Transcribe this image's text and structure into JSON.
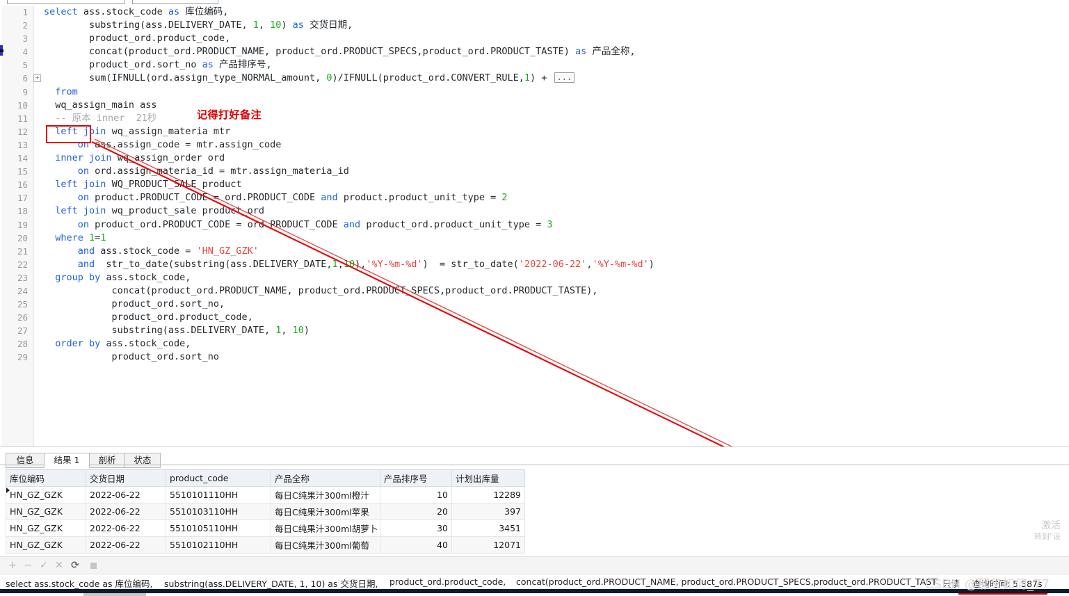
{
  "window": {
    "toolbar_boxes": [
      "",
      ""
    ]
  },
  "editor": {
    "lines": [
      {
        "n": "1",
        "fold": false,
        "indent": 0,
        "tokens": [
          {
            "t": "select",
            "c": "kw"
          },
          {
            "t": " ass.stock_code ",
            "c": ""
          },
          {
            "t": "as",
            "c": "kw"
          },
          {
            "t": " 库位编码,",
            "c": ""
          }
        ]
      },
      {
        "n": "2",
        "fold": false,
        "indent": 4,
        "tokens": [
          {
            "t": "substring(ass.DELIVERY_DATE, ",
            "c": ""
          },
          {
            "t": "1",
            "c": "num"
          },
          {
            "t": ", ",
            "c": ""
          },
          {
            "t": "10",
            "c": "num"
          },
          {
            "t": ") ",
            "c": ""
          },
          {
            "t": "as",
            "c": "kw"
          },
          {
            "t": " 交货日期,",
            "c": ""
          }
        ]
      },
      {
        "n": "3",
        "fold": false,
        "indent": 4,
        "tokens": [
          {
            "t": "product_ord.product_code,",
            "c": ""
          }
        ]
      },
      {
        "n": "4",
        "fold": false,
        "indent": 4,
        "tokens": [
          {
            "t": "concat(product_ord.PRODUCT_NAME, product_ord.PRODUCT_SPECS,product_ord.PRODUCT_TASTE) ",
            "c": ""
          },
          {
            "t": "as",
            "c": "kw"
          },
          {
            "t": " 产品全称,",
            "c": ""
          }
        ]
      },
      {
        "n": "5",
        "fold": false,
        "indent": 4,
        "tokens": [
          {
            "t": "product_ord.sort_no ",
            "c": ""
          },
          {
            "t": "as",
            "c": "kw"
          },
          {
            "t": " 产品排序号,",
            "c": ""
          }
        ]
      },
      {
        "n": "6",
        "fold": true,
        "indent": 4,
        "tokens": [
          {
            "t": "sum(IFNULL(ord.assign_type_NORMAL_amount, ",
            "c": ""
          },
          {
            "t": "0",
            "c": "num"
          },
          {
            "t": ")/IFNULL(product_ord.CONVERT_RULE,",
            "c": ""
          },
          {
            "t": "1",
            "c": "num"
          },
          {
            "t": ") + ",
            "c": ""
          },
          {
            "t": "...",
            "c": "ellipsis"
          }
        ]
      },
      {
        "n": "9",
        "fold": false,
        "indent": 1,
        "tokens": [
          {
            "t": "from",
            "c": "kw"
          }
        ]
      },
      {
        "n": "10",
        "fold": false,
        "indent": 1,
        "tokens": [
          {
            "t": "wq_assign_main ass",
            "c": ""
          }
        ]
      },
      {
        "n": "11",
        "fold": false,
        "indent": 1,
        "tokens": [
          {
            "t": "-- 原本 inner  21秒",
            "c": "cmt"
          }
        ]
      },
      {
        "n": "12",
        "fold": false,
        "indent": 1,
        "tokens": [
          {
            "t": "left",
            "c": "kw"
          },
          {
            "t": " ",
            "c": ""
          },
          {
            "t": "join",
            "c": "kw"
          },
          {
            "t": " wq_assign_materia mtr",
            "c": ""
          }
        ]
      },
      {
        "n": "13",
        "fold": false,
        "indent": 3,
        "tokens": [
          {
            "t": "on",
            "c": "kw"
          },
          {
            "t": " ass.assign_code = mtr.assign_code",
            "c": ""
          }
        ]
      },
      {
        "n": "14",
        "fold": false,
        "indent": 1,
        "tokens": [
          {
            "t": "inner",
            "c": "kw"
          },
          {
            "t": " ",
            "c": ""
          },
          {
            "t": "join",
            "c": "kw"
          },
          {
            "t": " wq_assign_order ord",
            "c": ""
          }
        ]
      },
      {
        "n": "15",
        "fold": false,
        "indent": 3,
        "tokens": [
          {
            "t": "on",
            "c": "kw"
          },
          {
            "t": " ord.assign_materia_id = mtr.assign_materia_id",
            "c": ""
          }
        ]
      },
      {
        "n": "16",
        "fold": false,
        "indent": 1,
        "tokens": [
          {
            "t": "left",
            "c": "kw"
          },
          {
            "t": " ",
            "c": ""
          },
          {
            "t": "join",
            "c": "kw"
          },
          {
            "t": " WQ_PRODUCT_SALE product",
            "c": ""
          }
        ]
      },
      {
        "n": "17",
        "fold": false,
        "indent": 3,
        "tokens": [
          {
            "t": "on",
            "c": "kw"
          },
          {
            "t": " product.PRODUCT_CODE = ord.PRODUCT_CODE ",
            "c": ""
          },
          {
            "t": "and",
            "c": "kw"
          },
          {
            "t": " product.product_unit_type = ",
            "c": ""
          },
          {
            "t": "2",
            "c": "num"
          }
        ]
      },
      {
        "n": "18",
        "fold": false,
        "indent": 1,
        "tokens": [
          {
            "t": "left",
            "c": "kw"
          },
          {
            "t": " ",
            "c": ""
          },
          {
            "t": "join",
            "c": "kw"
          },
          {
            "t": " wq_product_sale product_ord",
            "c": ""
          }
        ]
      },
      {
        "n": "19",
        "fold": false,
        "indent": 3,
        "tokens": [
          {
            "t": "on",
            "c": "kw"
          },
          {
            "t": " product_ord.PRODUCT_CODE = ord.PRODUCT_CODE ",
            "c": ""
          },
          {
            "t": "and",
            "c": "kw"
          },
          {
            "t": " product_ord.product_unit_type = ",
            "c": ""
          },
          {
            "t": "3",
            "c": "num"
          }
        ]
      },
      {
        "n": "20",
        "fold": false,
        "indent": 1,
        "tokens": [
          {
            "t": "where",
            "c": "kw"
          },
          {
            "t": " ",
            "c": ""
          },
          {
            "t": "1",
            "c": "num"
          },
          {
            "t": "=",
            "c": ""
          },
          {
            "t": "1",
            "c": "num"
          }
        ]
      },
      {
        "n": "21",
        "fold": false,
        "indent": 3,
        "tokens": [
          {
            "t": "and",
            "c": "kw"
          },
          {
            "t": " ass.stock_code = ",
            "c": ""
          },
          {
            "t": "'HN_GZ_GZK'",
            "c": "str"
          }
        ]
      },
      {
        "n": "22",
        "fold": false,
        "indent": 3,
        "tokens": [
          {
            "t": "and",
            "c": "kw"
          },
          {
            "t": "  str_to_date(substring(ass.DELIVERY_DATE,",
            "c": ""
          },
          {
            "t": "1",
            "c": "num"
          },
          {
            "t": ",",
            "c": ""
          },
          {
            "t": "10",
            "c": "num"
          },
          {
            "t": "),",
            "c": ""
          },
          {
            "t": "'%Y-%m-%d'",
            "c": "str"
          },
          {
            "t": ")  = str_to_date(",
            "c": ""
          },
          {
            "t": "'2022-06-22'",
            "c": "str"
          },
          {
            "t": ",",
            "c": ""
          },
          {
            "t": "'%Y-%m-%d'",
            "c": "str"
          },
          {
            "t": ")",
            "c": ""
          }
        ]
      },
      {
        "n": "23",
        "fold": false,
        "indent": 1,
        "tokens": [
          {
            "t": "group",
            "c": "kw"
          },
          {
            "t": " ",
            "c": ""
          },
          {
            "t": "by",
            "c": "kw"
          },
          {
            "t": " ass.stock_code,",
            "c": ""
          }
        ]
      },
      {
        "n": "24",
        "fold": false,
        "indent": 6,
        "tokens": [
          {
            "t": "concat(product_ord.PRODUCT_NAME, product_ord.PRODUCT_SPECS,product_ord.PRODUCT_TASTE),",
            "c": ""
          }
        ]
      },
      {
        "n": "25",
        "fold": false,
        "indent": 6,
        "tokens": [
          {
            "t": "product_ord.sort_no,",
            "c": ""
          }
        ]
      },
      {
        "n": "26",
        "fold": false,
        "indent": 6,
        "tokens": [
          {
            "t": "product_ord.product_code,",
            "c": ""
          }
        ]
      },
      {
        "n": "27",
        "fold": false,
        "indent": 6,
        "tokens": [
          {
            "t": "substring(ass.DELIVERY_DATE, ",
            "c": ""
          },
          {
            "t": "1",
            "c": "num"
          },
          {
            "t": ", ",
            "c": ""
          },
          {
            "t": "10",
            "c": "num"
          },
          {
            "t": ")",
            "c": ""
          }
        ]
      },
      {
        "n": "28",
        "fold": false,
        "indent": 1,
        "tokens": [
          {
            "t": "order",
            "c": "kw"
          },
          {
            "t": " ",
            "c": ""
          },
          {
            "t": "by",
            "c": "kw"
          },
          {
            "t": " ass.stock_code,",
            "c": ""
          }
        ]
      },
      {
        "n": "29",
        "fold": false,
        "indent": 6,
        "tokens": [
          {
            "t": "product_ord.sort_no",
            "c": ""
          }
        ]
      }
    ]
  },
  "annotations": {
    "note_text": "记得打好备注",
    "note_color": "#e00000",
    "highlight_keyword": "left",
    "arrow_color": "#e01010"
  },
  "results": {
    "tabs": [
      {
        "label": "信息",
        "active": false
      },
      {
        "label": "结果 1",
        "active": true
      },
      {
        "label": "剖析",
        "active": false
      },
      {
        "label": "状态",
        "active": false
      }
    ],
    "columns": [
      "库位编码",
      "交货日期",
      "product_code",
      "产品全称",
      "产品排序号",
      "计划出库量"
    ],
    "rows": [
      [
        "HN_GZ_GZK",
        "2022-06-22",
        "5510101110HH",
        "每日C纯果汁300ml橙汁",
        "10",
        "12289"
      ],
      [
        "HN_GZ_GZK",
        "2022-06-22",
        "5510103110HH",
        "每日C纯果汁300ml苹果",
        "20",
        "397"
      ],
      [
        "HN_GZ_GZK",
        "2022-06-22",
        "5510105110HH",
        "每日C纯果汁300ml胡萝卜",
        "30",
        "3451"
      ],
      [
        "HN_GZ_GZK",
        "2022-06-22",
        "5510102110HH",
        "每日C纯果汁300ml葡萄",
        "40",
        "12071"
      ]
    ]
  },
  "bottom_toolbar": {
    "icons": [
      "plus-icon",
      "minus-icon",
      "check-icon",
      "cross-icon",
      "refresh-icon",
      "stop-icon"
    ],
    "glyphs": [
      "+",
      "−",
      "✓",
      "✕",
      "⟳",
      ""
    ]
  },
  "statusbar": {
    "segments": [
      "select ass.stock_code as 库位编码,",
      "substring(ass.DELIVERY_DATE, 1, 10) as 交货日期,",
      "product_ord.product_code,",
      "concat(product_ord.PRODUCT_NAME, product_ord.PRODUCT_SPECS,product_ord.PRODUCT_TAST"
    ],
    "readonly_label": "只读",
    "query_time": "查询时间: 5.587s"
  },
  "watermarks": {
    "windows_activate_line1": "激活",
    "windows_activate_line2": "转到\"设",
    "csdn": "CSDN @那叉如何_77"
  }
}
